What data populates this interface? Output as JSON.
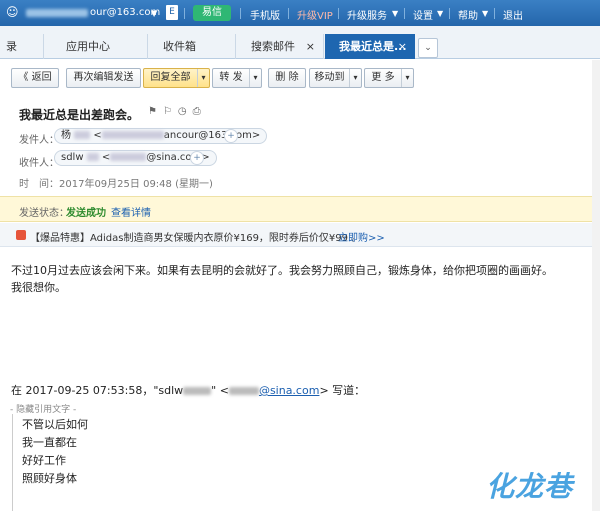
{
  "topbar": {
    "user_email": "our@163.com",
    "user_caret": "▼",
    "yixin_label": "易信",
    "mobile_label": "手机版",
    "vip_label": "升级VIP",
    "upgrade_label": "升级服务",
    "settings_label": "设置",
    "help_label": "帮助",
    "logout_label": "退出",
    "caret": "▼"
  },
  "tabs": [
    {
      "label": "录"
    },
    {
      "label": "应用中心"
    },
    {
      "label": "收件箱"
    },
    {
      "label": "搜索邮件",
      "close": "×"
    },
    {
      "label": "我最近总是...",
      "close": "×"
    }
  ],
  "tab_more": "⌄",
  "toolbar": {
    "back": "《 返回",
    "reedit": "再次编辑发送",
    "reply_all": "回复全部",
    "forward": "转 发",
    "delete": "删 除",
    "move_to": "移动到",
    "more": "更 多",
    "dropdown": "▾"
  },
  "mail": {
    "subject": "我最近总是出差跑会。",
    "subject_icons": "⚑⚐◷⎙",
    "from_label": "发件人：",
    "from_name": "杨",
    "from_email": "ancour@163.com>",
    "to_label": "收件人：",
    "to_name": "sdlw",
    "to_email": "@sina.com>",
    "plus": "+",
    "time_line": "时　间：2017年09月25日 09:48 (星期一)"
  },
  "status": {
    "label": "发送状态：",
    "value": "发送成功",
    "details": "查看详情"
  },
  "ad": {
    "text": "【爆品特惠】Adidas制造商男女保暖内衣原价¥169，限时券后价仅¥99 。",
    "link": "立即购>>"
  },
  "body": {
    "line1": "不过10月过去应该会闲下来。如果有去昆明的会就好了。我会努力照顾自己，锻炼身体，给你把项圈的画画好。",
    "line2": "我很想你。"
  },
  "quote": {
    "prefix": "在 2017-09-25 07:53:58，\"sdlw",
    "middle": "\" <",
    "link": "@sina.com",
    "suffix": "> 写道：",
    "toggle": "- 隐藏引用文字 -",
    "lines": [
      "不管以后如何",
      "我一直都在",
      "好好工作",
      "照顾好身体"
    ]
  },
  "watermark": "化龙巷",
  "colors": {
    "topbar": "#2c72b8",
    "active_tab": "#1e66b0",
    "yixin": "#2fb774",
    "status_bg": "#fff8d8",
    "success": "#2e8b2e",
    "link": "#1b5fb0"
  }
}
